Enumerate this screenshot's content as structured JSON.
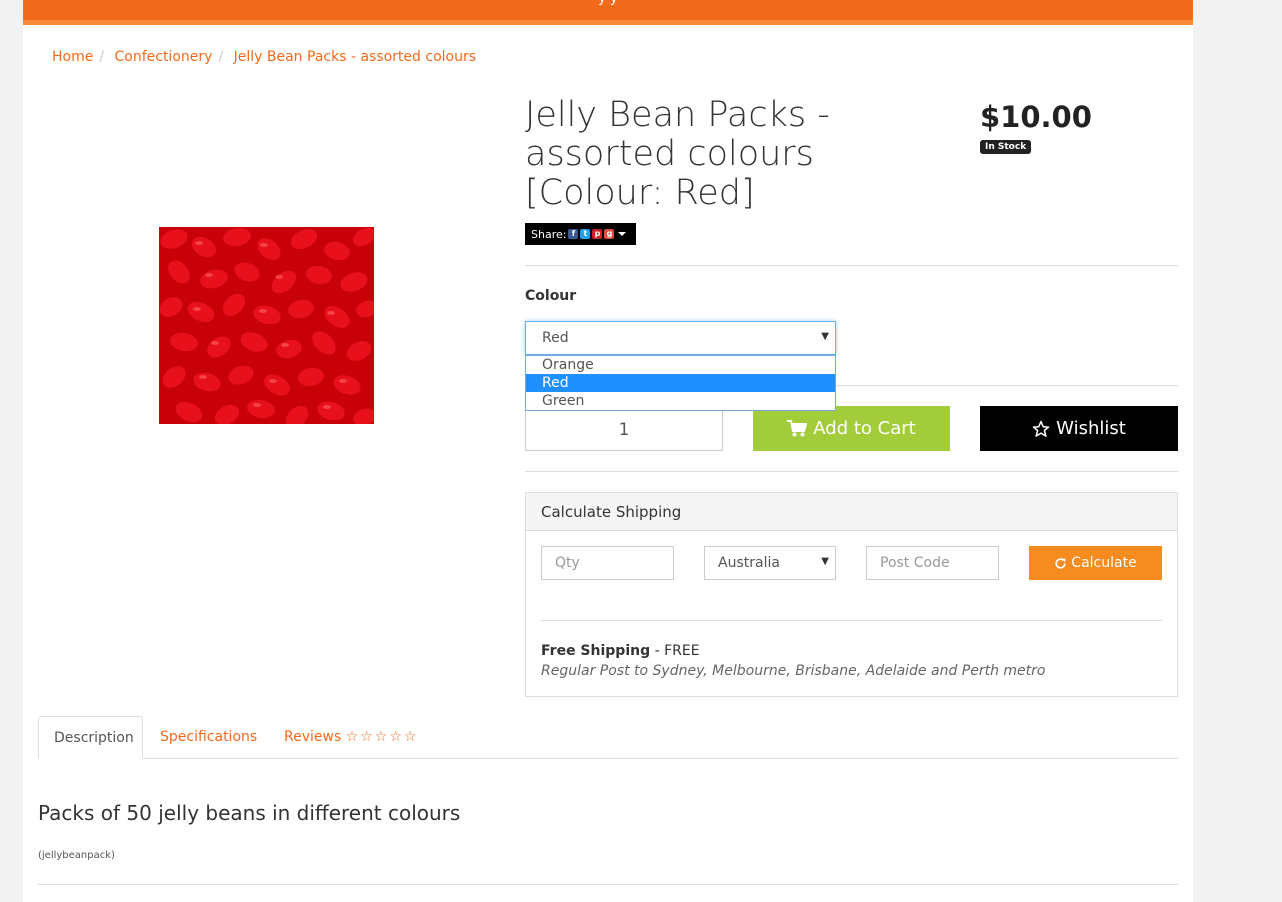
{
  "topbar": {
    "text": "y                    y"
  },
  "breadcrumb": [
    "Home",
    "Confectionery",
    "Jelly Bean Packs - assorted colours"
  ],
  "product": {
    "title": "Jelly Bean Packs - assorted colours [Colour: Red]",
    "price": "$10.00",
    "stock": "In Stock",
    "share_label": "Share:"
  },
  "options": {
    "colour_label": "Colour",
    "selected": "Red",
    "items": [
      "Orange",
      "Red",
      "Green"
    ]
  },
  "cart": {
    "qty": "1",
    "add_label": "Add to Cart",
    "wishlist_label": "Wishlist"
  },
  "shipping": {
    "heading": "Calculate Shipping",
    "qty_placeholder": "Qty",
    "country": "Australia",
    "postcode_placeholder": "Post Code",
    "calc_label": "Calculate",
    "method_name": "Free Shipping",
    "method_price": " - FREE",
    "method_desc": "Regular Post to Sydney, Melbourne, Brisbane, Adelaide and Perth metro"
  },
  "tabs": {
    "description": "Description",
    "specifications": "Specifications",
    "reviews": "Reviews",
    "stars": "☆☆☆☆☆"
  },
  "description": {
    "title": "Packs of 50 jelly beans in different colours",
    "code": "(jellybeanpack)"
  },
  "colors": {
    "accent": "#f26a1b",
    "cart_button": "#a3cc3a",
    "calc_button": "#f68b1f",
    "selected_option": "#1e90ff"
  }
}
